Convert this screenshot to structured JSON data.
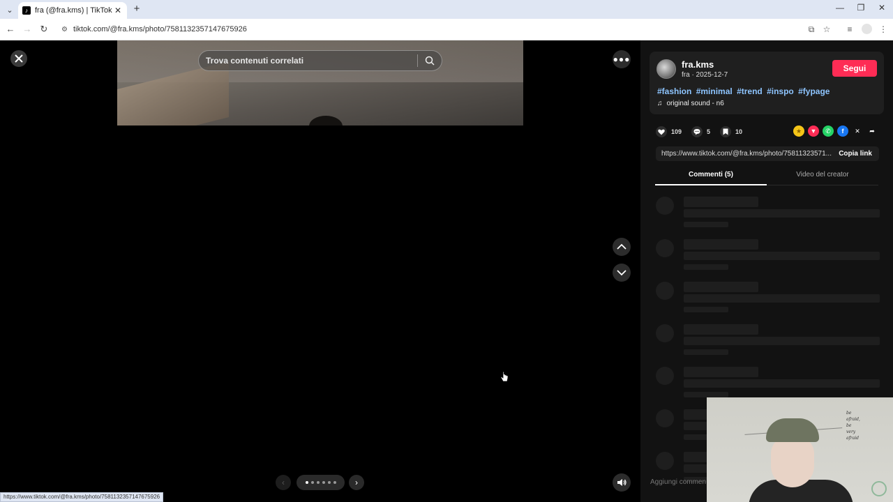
{
  "browser": {
    "tab_title": "fra (@fra.kms) | TikTok",
    "tab_favicon": "tiktok-icon",
    "url": "tiktok.com/@fra.kms/photo/7581132357147675926",
    "status_url": "https://www.tiktok.com/@fra.kms/photo/7581132357147675926"
  },
  "viewer": {
    "search_placeholder": "Trova contenuti correlati",
    "slides": {
      "count": 6,
      "active": 0
    }
  },
  "post": {
    "username": "fra.kms",
    "subline": "fra · 2025-12-7",
    "follow_label": "Segui",
    "hashtags": [
      "#fashion",
      "#minimal",
      "#trend",
      "#inspo",
      "#fypage"
    ],
    "sound": "original sound - n6",
    "likes": "109",
    "comments": "5",
    "saves": "10",
    "share_link": "https://www.tiktok.com/@fra.kms/photo/75811323571...",
    "copy_label": "Copia link"
  },
  "tabs": {
    "comments": "Commenti (5)",
    "creator_videos": "Video del creator"
  },
  "comment_input": {
    "placeholder": "Aggiungi commento..."
  },
  "webcam": {
    "poster_text": [
      "be",
      "afraid,",
      "be",
      "very",
      "afraid"
    ]
  },
  "colors": {
    "accent": "#fe2c55",
    "hashtag": "#8ec5ff",
    "panel_bg": "#121212",
    "card_bg": "#1f1f1f"
  }
}
